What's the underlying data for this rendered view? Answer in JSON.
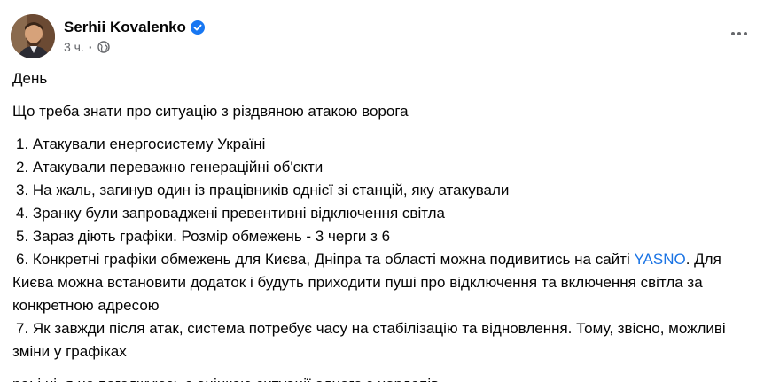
{
  "post": {
    "author": "Serhii Kovalenko",
    "timestamp": "3 ч.",
    "separator": "·",
    "verified_icon": "verified-badge-icon",
    "audience_icon": "globe-icon",
    "more_icon": "more-options-icon",
    "colors": {
      "link": "#1b74e4",
      "verified": "#1877f2",
      "secondary_text": "#65676b"
    }
  },
  "content": {
    "title": "День",
    "intro": "Що треба знати про ситуацію з різдвяною атакою ворога",
    "items": [
      " 1. Атакували енергосистему Україні",
      " 2. Атакували переважно генераційні об'єкти",
      " 3. На жаль, загинув один із працівників однієї зі станцій, яку атакували",
      " 4. Зранку були запроваджені превентивні відключення світла",
      " 5. Зараз діють графіки. Розмір обмежень - 3 черги з 6"
    ],
    "item6_prefix": " 6. Конкретні графіки обмежень для Києва, Дніпра та області можна подивитись на сайті ",
    "item6_link": "YASNO",
    "item6_suffix": ". Для Києва можна встановити додаток і будуть приходити пуші про відключення та включення світла за конкретною адресою",
    "item7": " 7. Як завжди після атак, система потребує часу на стабілізацію та відновлення. Тому, звісно, можливі зміни у графіках",
    "ps": "ра: і ні, я не погоджуюсь з оцінкою ситуації одного з нардепів"
  }
}
